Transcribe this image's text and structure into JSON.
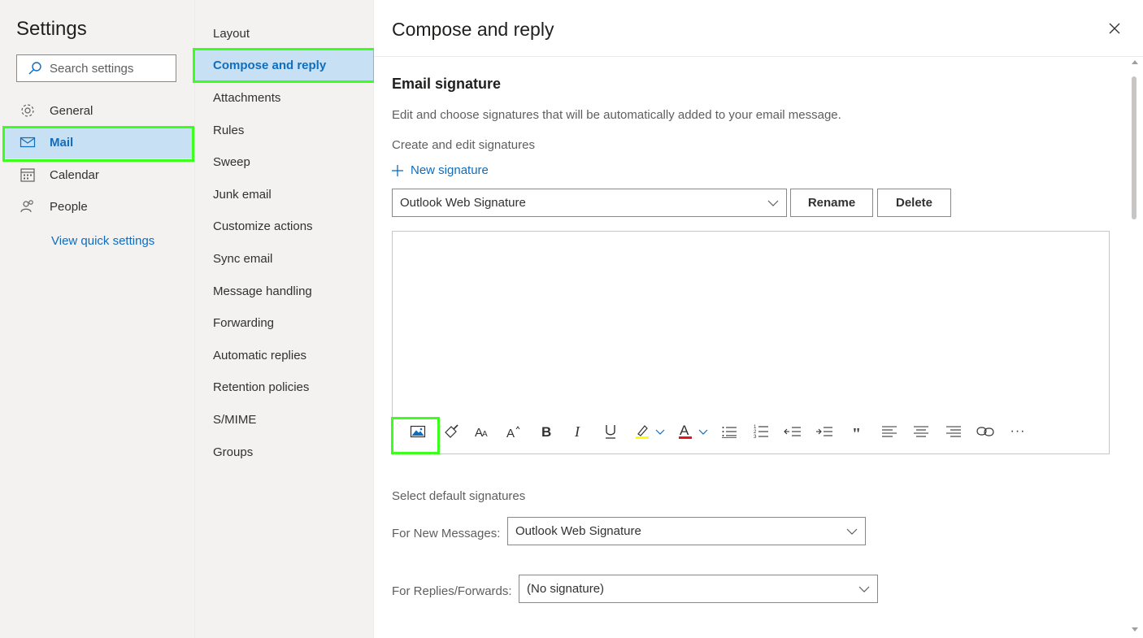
{
  "left_nav": {
    "title": "Settings",
    "search_placeholder": "Search settings",
    "items": [
      {
        "label": "General",
        "icon": "gear-icon"
      },
      {
        "label": "Mail",
        "icon": "mail-icon"
      },
      {
        "label": "Calendar",
        "icon": "calendar-icon"
      },
      {
        "label": "People",
        "icon": "people-icon"
      }
    ],
    "quick_settings": "View quick settings"
  },
  "mid_nav": {
    "items": [
      {
        "label": "Layout"
      },
      {
        "label": "Compose and reply"
      },
      {
        "label": "Attachments"
      },
      {
        "label": "Rules"
      },
      {
        "label": "Sweep"
      },
      {
        "label": "Junk email"
      },
      {
        "label": "Customize actions"
      },
      {
        "label": "Sync email"
      },
      {
        "label": "Message handling"
      },
      {
        "label": "Forwarding"
      },
      {
        "label": "Automatic replies"
      },
      {
        "label": "Retention policies"
      },
      {
        "label": "S/MIME"
      },
      {
        "label": "Groups"
      }
    ]
  },
  "main": {
    "title": "Compose and reply",
    "section_title": "Email signature",
    "description": "Edit and choose signatures that will be automatically added to your email message.",
    "create_label": "Create and edit signatures",
    "new_signature": "New signature",
    "signature_select": "Outlook Web Signature",
    "rename": "Rename",
    "delete": "Delete",
    "toolbar": {
      "icons": [
        "insert-image-icon",
        "format-painter-icon",
        "font-size-icon",
        "grow-font-icon",
        "bold-icon",
        "italic-icon",
        "underline-icon",
        "highlight-icon",
        "font-color-icon",
        "bullets-icon",
        "numbering-icon",
        "decrease-indent-icon",
        "increase-indent-icon",
        "quote-icon",
        "align-left-icon",
        "align-center-icon",
        "align-right-icon",
        "link-icon",
        "more-options-icon"
      ],
      "highlight_color": "#ffff00",
      "font_color": "#e81123",
      "more_label": "···"
    },
    "select_default_label": "Select default signatures",
    "new_messages_label": "For New Messages:",
    "new_messages_value": "Outlook Web Signature",
    "replies_label": "For Replies/Forwards:",
    "replies_value": "(No signature)"
  },
  "colors": {
    "accent": "#0f6cbd",
    "selected_bg": "#c7e0f4",
    "highlight_box": "#3cff1e"
  }
}
